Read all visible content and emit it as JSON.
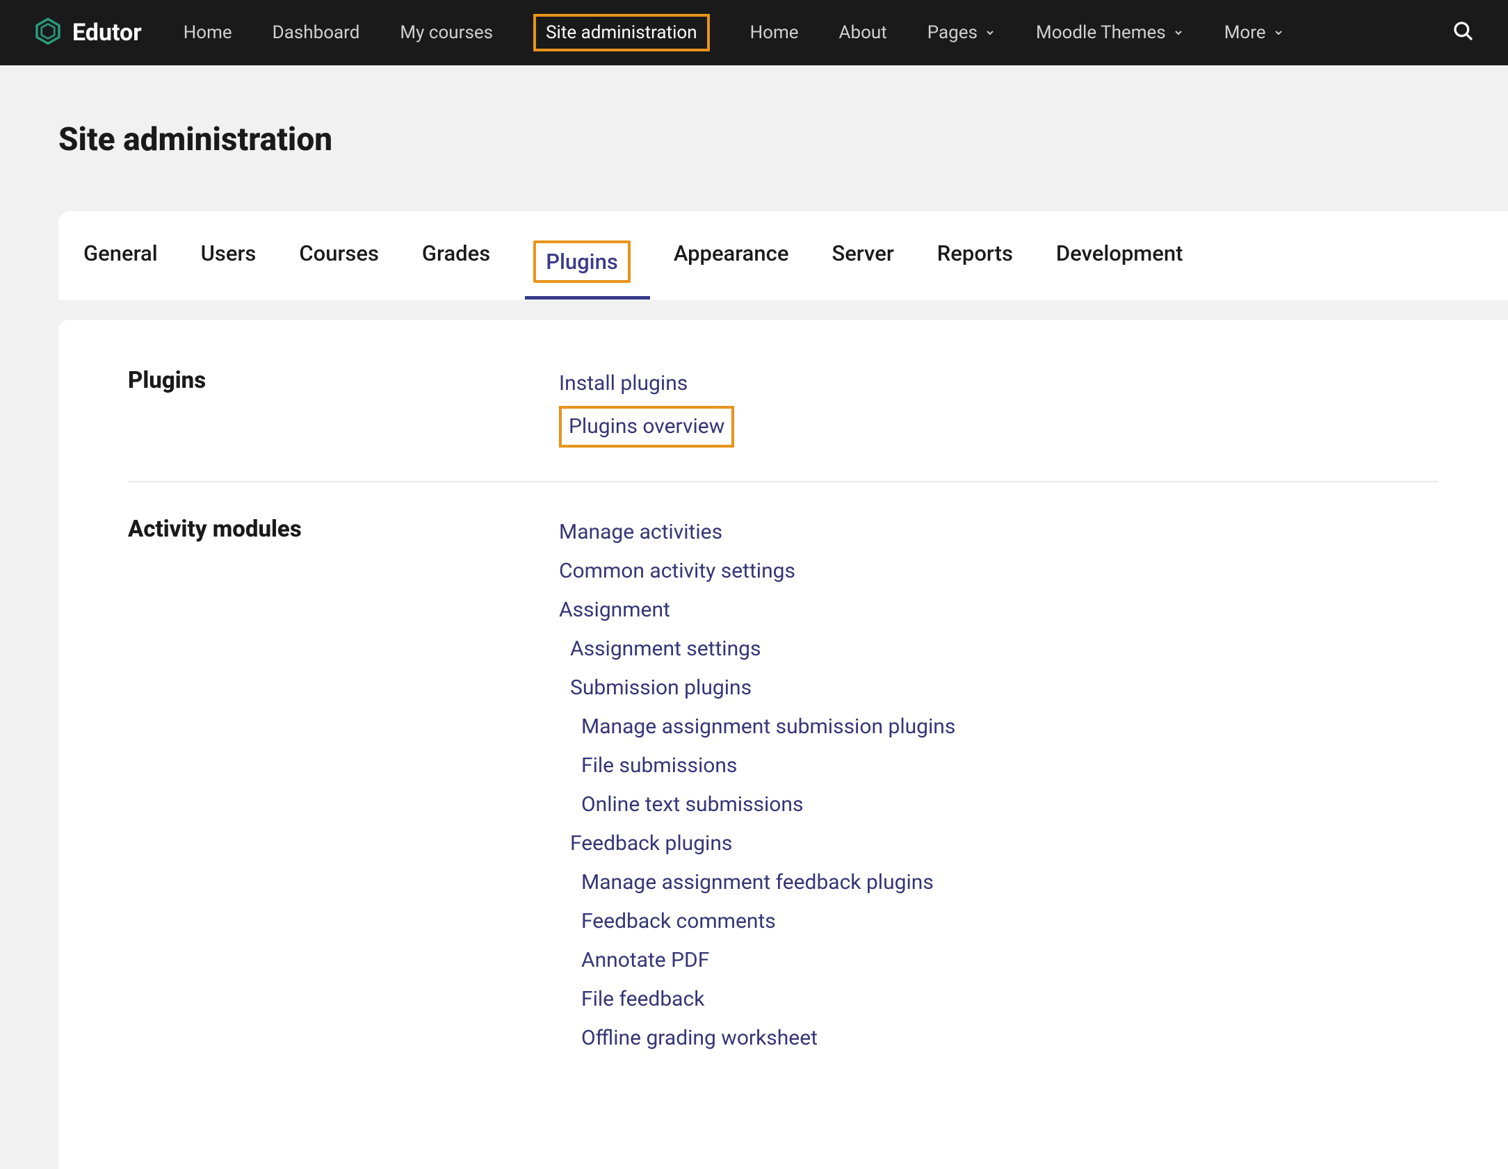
{
  "header": {
    "logo_text": "Edutor",
    "nav": [
      {
        "label": "Home",
        "highlighted": false,
        "dropdown": false
      },
      {
        "label": "Dashboard",
        "highlighted": false,
        "dropdown": false
      },
      {
        "label": "My courses",
        "highlighted": false,
        "dropdown": false
      },
      {
        "label": "Site administration",
        "highlighted": true,
        "dropdown": false
      },
      {
        "label": "Home",
        "highlighted": false,
        "dropdown": false
      },
      {
        "label": "About",
        "highlighted": false,
        "dropdown": false
      },
      {
        "label": "Pages",
        "highlighted": false,
        "dropdown": true
      },
      {
        "label": "Moodle Themes",
        "highlighted": false,
        "dropdown": true
      },
      {
        "label": "More",
        "highlighted": false,
        "dropdown": true
      }
    ]
  },
  "page": {
    "title": "Site administration"
  },
  "tabs": [
    {
      "label": "General",
      "active": false,
      "highlighted": false
    },
    {
      "label": "Users",
      "active": false,
      "highlighted": false
    },
    {
      "label": "Courses",
      "active": false,
      "highlighted": false
    },
    {
      "label": "Grades",
      "active": false,
      "highlighted": false
    },
    {
      "label": "Plugins",
      "active": true,
      "highlighted": true
    },
    {
      "label": "Appearance",
      "active": false,
      "highlighted": false
    },
    {
      "label": "Server",
      "active": false,
      "highlighted": false
    },
    {
      "label": "Reports",
      "active": false,
      "highlighted": false
    },
    {
      "label": "Development",
      "active": false,
      "highlighted": false
    }
  ],
  "sections": [
    {
      "title": "Plugins",
      "bordered": true,
      "links": [
        {
          "label": "Install plugins",
          "indent": 0,
          "highlighted": false
        },
        {
          "label": "Plugins overview",
          "indent": 0,
          "highlighted": true
        }
      ]
    },
    {
      "title": "Activity modules",
      "bordered": false,
      "links": [
        {
          "label": "Manage activities",
          "indent": 0,
          "highlighted": false
        },
        {
          "label": "Common activity settings",
          "indent": 0,
          "highlighted": false
        },
        {
          "label": "Assignment",
          "indent": 0,
          "highlighted": false
        },
        {
          "label": "Assignment settings",
          "indent": 1,
          "highlighted": false
        },
        {
          "label": "Submission plugins",
          "indent": 1,
          "highlighted": false
        },
        {
          "label": "Manage assignment submission plugins",
          "indent": 2,
          "highlighted": false
        },
        {
          "label": "File submissions",
          "indent": 2,
          "highlighted": false
        },
        {
          "label": "Online text submissions",
          "indent": 2,
          "highlighted": false
        },
        {
          "label": "Feedback plugins",
          "indent": 1,
          "highlighted": false
        },
        {
          "label": "Manage assignment feedback plugins",
          "indent": 2,
          "highlighted": false
        },
        {
          "label": "Feedback comments",
          "indent": 2,
          "highlighted": false
        },
        {
          "label": "Annotate PDF",
          "indent": 2,
          "highlighted": false
        },
        {
          "label": "File feedback",
          "indent": 2,
          "highlighted": false
        },
        {
          "label": "Offline grading worksheet",
          "indent": 2,
          "highlighted": false
        }
      ]
    }
  ]
}
